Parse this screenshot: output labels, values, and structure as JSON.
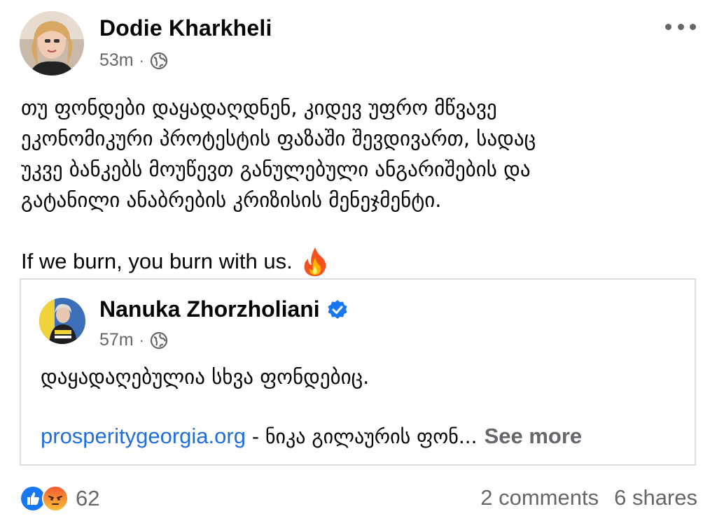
{
  "post": {
    "author": "Dodie Kharkheli",
    "time": "53m",
    "separator": "·",
    "privacy_icon": "globe-icon",
    "text_georgian": [
      "თუ ფონდები დაყადაღდნენ, კიდევ უფრო მწვავე",
      "ეკონომიკური პროტესტის ფაზაში შევდივართ, სადაც",
      "უკვე ბანკებს მოუწევთ განულებული ანგარიშების და",
      "გატანილი ანაბრების კრიზისის მენეჯმენტი."
    ],
    "text_english": "If we burn, you burn with us.",
    "emoji": "fire-icon"
  },
  "shared": {
    "author": "Nanuka Zhorzholiani",
    "verified_icon": "verified-badge-icon",
    "time": "57m",
    "separator": "·",
    "privacy_icon": "globe-icon",
    "text": "დაყადაღებულია სხვა ფონდებიც.",
    "link": "prosperitygeorgia.org",
    "link_suffix": " - ნიკა გილაურის ფონ...",
    "see_more": "See more"
  },
  "footer": {
    "reactions": [
      "like-icon",
      "angry-icon"
    ],
    "reaction_count": "62",
    "comments": "2 comments",
    "shares": "6 shares"
  },
  "colors": {
    "link": "#216fdb",
    "muted": "#65676b",
    "like": "#1877f2",
    "angry": "#f25a2f"
  }
}
